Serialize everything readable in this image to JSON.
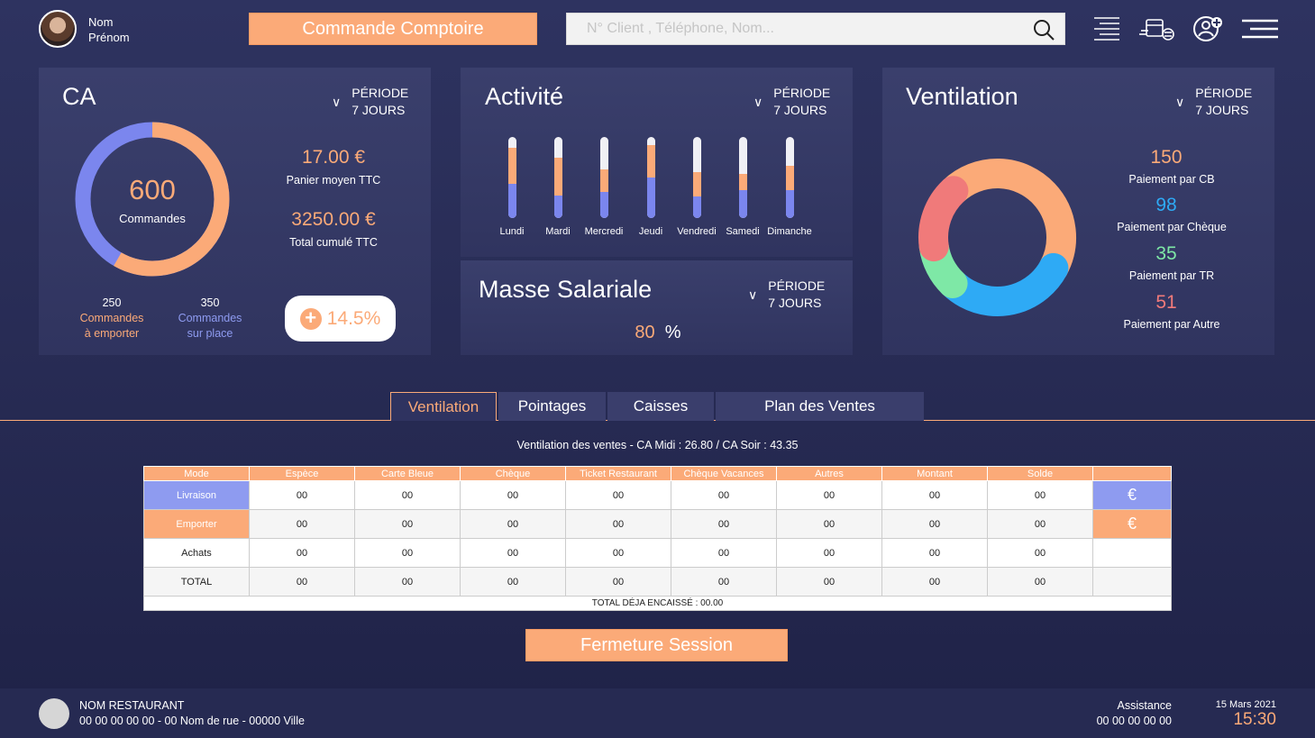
{
  "user": {
    "first_line": "Nom",
    "second_line": "Prénom"
  },
  "header": {
    "commande_button": "Commande Comptoire",
    "search_placeholder": "N° Client , Téléphone, Nom..."
  },
  "ca_card": {
    "title": "CA",
    "periode_label": "PÉRIODE",
    "periode_value": "7 JOURS",
    "donut_value": "600",
    "donut_label": "Commandes",
    "panier_value": "17.00 €",
    "panier_label": "Panier moyen TTC",
    "total_value": "3250.00 €",
    "total_label": "Total cumulé TTC",
    "emporter_count": "250",
    "emporter_label_1": "Commandes",
    "emporter_label_2": "à emporter",
    "surplace_count": "350",
    "surplace_label_1": "Commandes",
    "surplace_label_2": "sur place",
    "growth": "14.5%",
    "split": {
      "emporter": 250,
      "sur_place": 350
    },
    "colors": {
      "emporter": "#fbaa78",
      "sur_place": "#7b86ee"
    }
  },
  "activite_card": {
    "title": "Activité",
    "periode_label": "PÉRIODE",
    "periode_value": "7 JOURS",
    "days": [
      {
        "label": "Lundi",
        "blue": 0.42,
        "orange": 0.45
      },
      {
        "label": "Mardi",
        "blue": 0.28,
        "orange": 0.47
      },
      {
        "label": "Mercredi",
        "blue": 0.32,
        "orange": 0.28
      },
      {
        "label": "Jeudi",
        "blue": 0.5,
        "orange": 0.4
      },
      {
        "label": "Vendredi",
        "blue": 0.27,
        "orange": 0.3
      },
      {
        "label": "Samedi",
        "blue": 0.35,
        "orange": 0.2
      },
      {
        "label": "Dimanche",
        "blue": 0.35,
        "orange": 0.3
      }
    ]
  },
  "masse_card": {
    "title": "Masse Salariale",
    "periode_label": "PÉRIODE",
    "periode_value": "7 JOURS",
    "value": "80",
    "unit": "%"
  },
  "ventilation_card": {
    "title": "Ventilation",
    "periode_label": "PÉRIODE",
    "periode_value": "7 JOURS",
    "items": [
      {
        "value": "150",
        "label": "Paiement par CB",
        "color": "#fbaa78",
        "num": 150
      },
      {
        "value": "98",
        "label": "Paiement par Chèque",
        "color": "#2eaaf5",
        "num": 98
      },
      {
        "value": "35",
        "label": "Paiement par TR",
        "color": "#7ee8a6",
        "num": 35
      },
      {
        "value": "51",
        "label": "Paiement par Autre",
        "color": "#f07a7a",
        "num": 51
      }
    ]
  },
  "tabs": [
    "Ventilation",
    "Pointages",
    "Caisses",
    "Plan des Ventes"
  ],
  "table": {
    "caption": "Ventilation des ventes - CA Midi : 26.80 / CA Soir : 43.35",
    "headers": [
      "Mode",
      "Espèce",
      "Carte Bleue",
      "Chèque",
      "Ticket Restaurant",
      "Chèque Vacances",
      "Autres",
      "Montant",
      "Solde",
      ""
    ],
    "rows": [
      {
        "mode": "Livraison",
        "cells": [
          "00",
          "00",
          "00",
          "00",
          "00",
          "00",
          "00",
          "00"
        ],
        "euro": "€"
      },
      {
        "mode": "Emporter",
        "cells": [
          "00",
          "00",
          "00",
          "00",
          "00",
          "00",
          "00",
          "00"
        ],
        "euro": "€"
      },
      {
        "mode": "Achats",
        "cells": [
          "00",
          "00",
          "00",
          "00",
          "00",
          "00",
          "00",
          "00"
        ],
        "euro": ""
      },
      {
        "mode": "TOTAL",
        "cells": [
          "00",
          "00",
          "00",
          "00",
          "00",
          "00",
          "00",
          "00"
        ],
        "euro": ""
      }
    ],
    "footer": "TOTAL DÉJA ENCAISSÉ : 00.00"
  },
  "fermeture_button": "Fermeture Session",
  "footer": {
    "restaurant_name": "NOM RESTAURANT",
    "restaurant_address": "00 00 00 00 00 - 00 Nom de rue - 00000 Ville",
    "assistance_label": "Assistance",
    "assistance_phone": "00 00 00 00 00",
    "date": "15 Mars 2021",
    "time": "15:30"
  }
}
